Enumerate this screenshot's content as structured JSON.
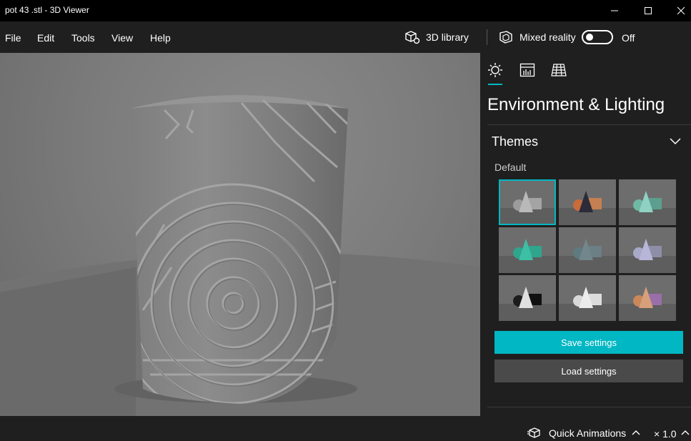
{
  "window": {
    "title": "pot 43 .stl - 3D Viewer"
  },
  "menu": {
    "items": [
      "File",
      "Edit",
      "Tools",
      "View",
      "Help"
    ],
    "library_label": "3D library",
    "mixed_reality_label": "Mixed reality",
    "toggle_state": "Off",
    "toggle_on": false
  },
  "viewport": {
    "model": "pot 43 .stl"
  },
  "panel": {
    "tabs": [
      {
        "icon": "sun-icon",
        "active": true
      },
      {
        "icon": "stats-icon",
        "active": false
      },
      {
        "icon": "grid-icon",
        "active": false
      }
    ],
    "title": "Environment & Lighting",
    "themes_label": "Themes",
    "selected_theme_label": "Default",
    "themes": [
      {
        "colors": [
          "#9c9c9c",
          "#b9b9b9",
          "#a4a4a4"
        ],
        "selected": true
      },
      {
        "colors": [
          "#c86c3c",
          "#2b2b3a",
          "#c48050"
        ],
        "selected": false
      },
      {
        "colors": [
          "#6fb8a4",
          "#8fd1c2",
          "#5c9f8e"
        ],
        "selected": false
      },
      {
        "colors": [
          "#2fa58d",
          "#3dbfa5",
          "#2fa58d"
        ],
        "selected": false
      },
      {
        "colors": [
          "#5f7a80",
          "#72878b",
          "#6b7f84"
        ],
        "selected": false
      },
      {
        "colors": [
          "#a8a8c8",
          "#b8b6d8",
          "#8e8ea8"
        ],
        "selected": false
      },
      {
        "colors": [
          "#1c1c1c",
          "#e0e0e0",
          "#111111"
        ],
        "selected": false
      },
      {
        "colors": [
          "#d8d8d8",
          "#ececec",
          "#dcdcdc"
        ],
        "selected": false
      },
      {
        "colors": [
          "#c9875a",
          "#d6a07a",
          "#9a6ea8"
        ],
        "selected": false
      }
    ],
    "save_label": "Save settings",
    "load_label": "Load settings"
  },
  "status": {
    "animations_label": "Quick Animations",
    "zoom_label": "× 1.0"
  }
}
